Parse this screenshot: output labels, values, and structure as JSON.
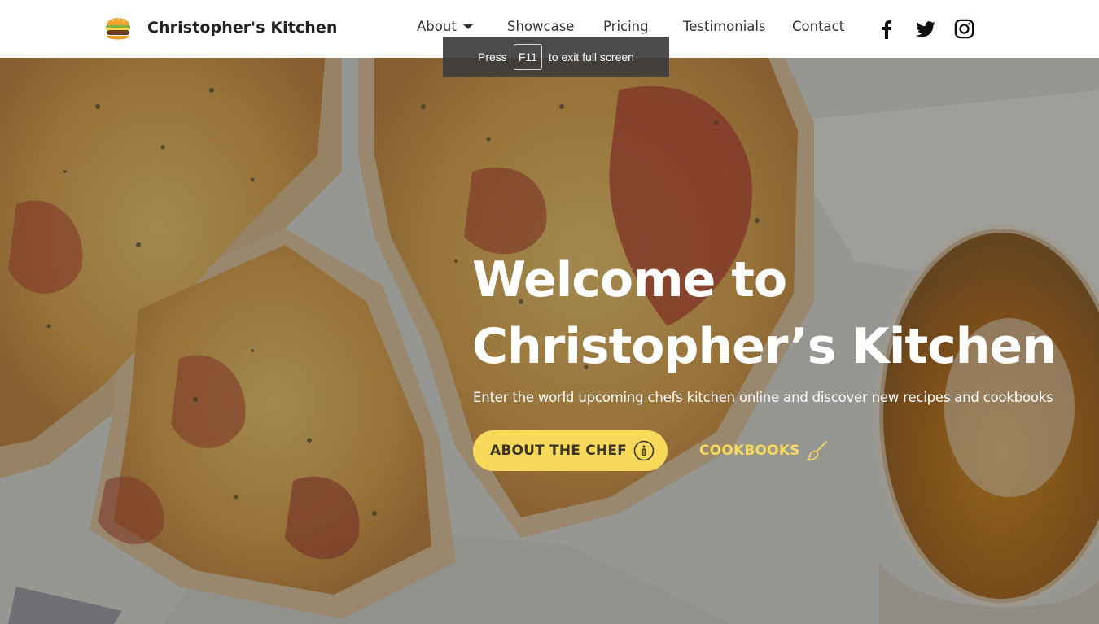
{
  "brand": {
    "name": "Christopher's Kitchen",
    "logo_icon": "burger-icon"
  },
  "nav": {
    "items": [
      {
        "label": "About",
        "has_dropdown": true
      },
      {
        "label": "Showcase"
      },
      {
        "label": "Pricing"
      },
      {
        "label": "Testimonials"
      },
      {
        "label": "Contact"
      }
    ],
    "social": [
      {
        "icon": "facebook-icon"
      },
      {
        "icon": "twitter-icon"
      },
      {
        "icon": "instagram-icon"
      }
    ]
  },
  "fullscreen_notice": {
    "before": "Press",
    "key": "F11",
    "after": "to exit full screen"
  },
  "hero": {
    "title_line1": "Welcome to",
    "title_line2": "Christopher’s Kitchen",
    "subtitle": "Enter the world upcoming chefs kitchen online and discover new recipes and cookbooks",
    "primary_button": {
      "label": "ABOUT THE CHEF",
      "icon": "info-icon"
    },
    "secondary_button": {
      "label": "COOKBOOKS",
      "icon": "brush-icon"
    }
  },
  "colors": {
    "accent": "#f8d959",
    "nav_text": "#333333",
    "hero_text": "#ffffff"
  }
}
